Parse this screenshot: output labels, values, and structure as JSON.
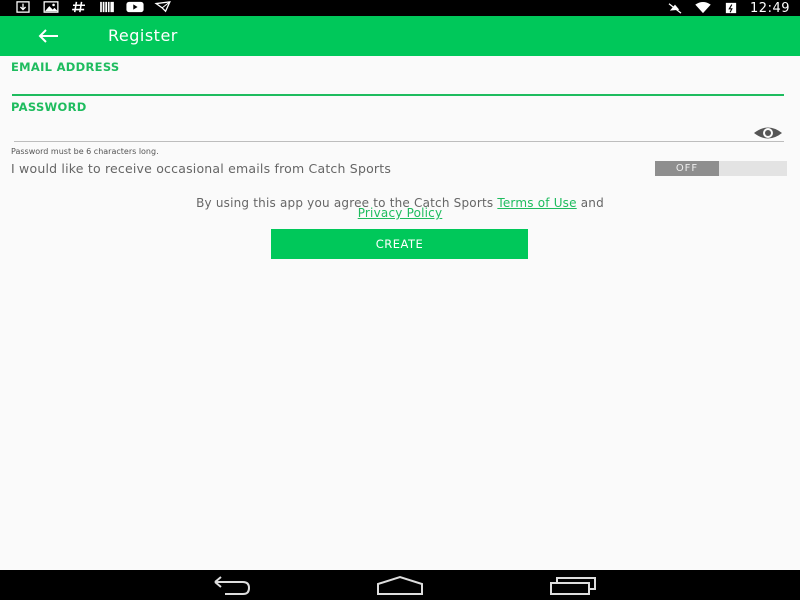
{
  "status_bar": {
    "time": "12:49",
    "left_icons": [
      "download-icon",
      "image-icon",
      "hash-icon",
      "barcode-icon",
      "youtube-icon",
      "mail-icon"
    ],
    "right_icons": [
      "mute-icon",
      "wifi-icon",
      "battery-icon"
    ]
  },
  "app_bar": {
    "title": "Register",
    "background": "#00c85a"
  },
  "form": {
    "email_label": "EMAIL ADDRESS",
    "email_value": "",
    "password_label": "PASSWORD",
    "password_value": "",
    "password_hint": "Password must be 6 characters long.",
    "optin_text": "I would like to receive occasional emails from Catch Sports",
    "optin_toggle": "OFF"
  },
  "terms": {
    "prefix": "By using this app you agree to the Catch Sports ",
    "terms_link": "Terms of Use",
    "conjunction": " and",
    "privacy_link": "Privacy Policy"
  },
  "create_button": "CREATE",
  "colors": {
    "accent": "#1ebc5e",
    "primary": "#00c85a",
    "toggle_off": "#8e8e8e"
  }
}
